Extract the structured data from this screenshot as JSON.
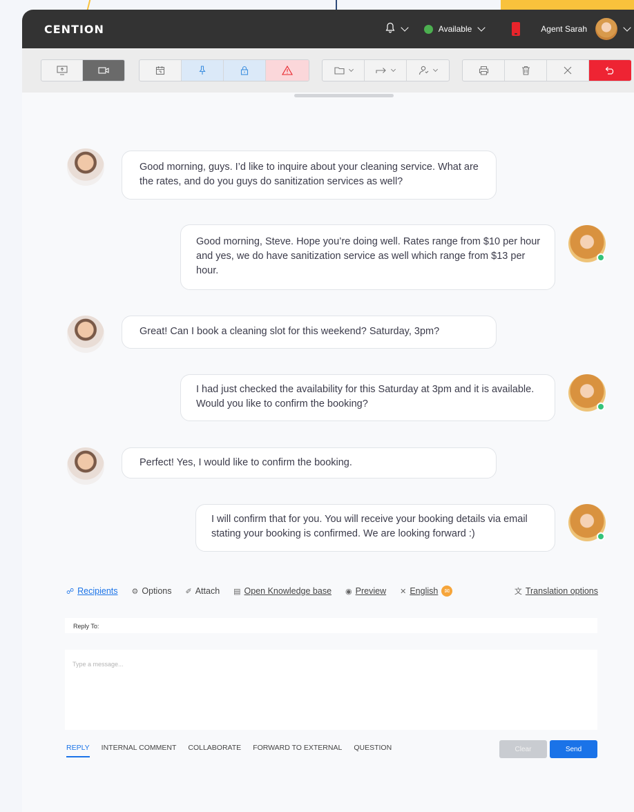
{
  "header": {
    "logo": "CENTION",
    "status_label": "Available",
    "agent_name": "Agent Sarah"
  },
  "toolbar": {
    "groups": [
      [
        "screen-share-icon",
        "video-call-icon"
      ],
      [
        "calendar-icon",
        "pin-icon",
        "lock-icon",
        "warning-icon"
      ],
      [
        "folder-icon",
        "forward-icon",
        "assign-user-icon"
      ],
      [
        "print-icon",
        "trash-icon",
        "close-icon",
        "undo-icon"
      ]
    ]
  },
  "conversation": [
    {
      "from": "customer",
      "text": "Good morning, guys. I’d like to inquire about your cleaning service. What are the rates, and do you guys do sanitization services as well?"
    },
    {
      "from": "agent",
      "text": "Good morning, Steve. Hope you’re doing well. Rates range from $10 per hour and yes, we do have sanitization service as well which range from $13 per hour."
    },
    {
      "from": "customer",
      "text": "Great! Can I book a cleaning slot for this weekend? Saturday, 3pm?"
    },
    {
      "from": "agent",
      "text": "I had just checked the availability for this Saturday at 3pm and it is available. Would you like to confirm the booking?"
    },
    {
      "from": "customer",
      "text": "Perfect! Yes, I would like to confirm the booking."
    },
    {
      "from": "agent",
      "text": "I will confirm that for you. You will receive your booking details via email stating your booking is confirmed. We are looking forward :)"
    }
  ],
  "reply_tools": {
    "recipients": "Recipients",
    "options": "Options",
    "attach": "Attach",
    "knowledge_base": "Open Knowledge base",
    "preview": "Preview",
    "language": "English",
    "translation": "Translation options"
  },
  "composer": {
    "reply_to_label": "Reply To:",
    "placeholder": "Type a message..."
  },
  "tabs": [
    "REPLY",
    "INTERNAL COMMENT",
    "COLLABORATE",
    "FORWARD TO EXTERNAL",
    "QUESTION"
  ],
  "buttons": {
    "clear": "Clear",
    "send": "Send"
  },
  "colors": {
    "accent": "#1a73e8",
    "header": "#333333",
    "danger": "#ee2433",
    "online": "#34c37b"
  }
}
